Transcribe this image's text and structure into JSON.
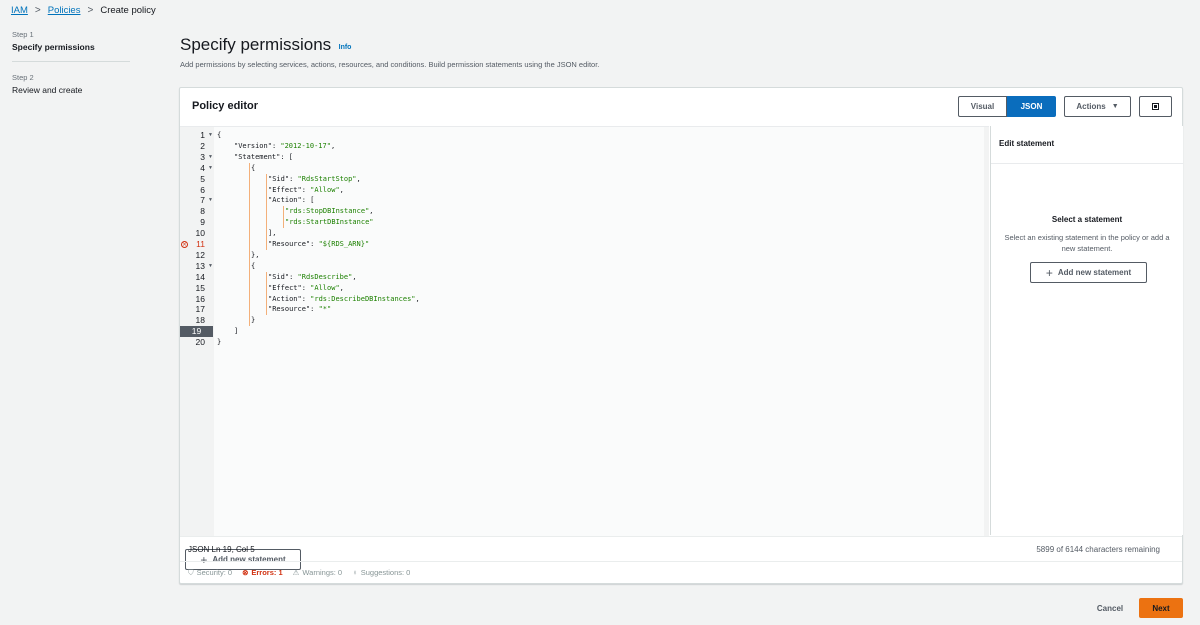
{
  "breadcrumb": {
    "iam": "IAM",
    "policies": "Policies",
    "current": "Create policy",
    "separator": ">"
  },
  "steps": [
    {
      "num": "Step 1",
      "title": "Specify permissions",
      "active": true
    },
    {
      "num": "Step 2",
      "title": "Review and create",
      "active": false
    }
  ],
  "page": {
    "title": "Specify permissions",
    "info": "Info",
    "description": "Add permissions by selecting services, actions, resources, and conditions. Build permission statements using the JSON editor."
  },
  "editor": {
    "title": "Policy editor",
    "mode_visual": "Visual",
    "mode_json": "JSON",
    "actions_label": "Actions",
    "add_statement": "Add new statement",
    "error_line": 11,
    "active_line": 19,
    "lines": [
      {
        "n": "1",
        "fold": true,
        "indent": 0,
        "tokens": [
          [
            "p",
            "{"
          ]
        ]
      },
      {
        "n": "2",
        "fold": false,
        "indent": 1,
        "tokens": [
          [
            "k",
            "\"Version\""
          ],
          [
            "p",
            ": "
          ],
          [
            "s",
            "\"2012-10-17\""
          ],
          [
            "p",
            ","
          ]
        ]
      },
      {
        "n": "3",
        "fold": true,
        "indent": 1,
        "tokens": [
          [
            "k",
            "\"Statement\""
          ],
          [
            "p",
            ": ["
          ]
        ]
      },
      {
        "n": "4",
        "fold": true,
        "indent": 2,
        "tokens": [
          [
            "p",
            "{"
          ]
        ]
      },
      {
        "n": "5",
        "fold": false,
        "indent": 3,
        "tokens": [
          [
            "k",
            "\"Sid\""
          ],
          [
            "p",
            ": "
          ],
          [
            "s",
            "\"RdsStartStop\""
          ],
          [
            "p",
            ","
          ]
        ]
      },
      {
        "n": "6",
        "fold": false,
        "indent": 3,
        "tokens": [
          [
            "k",
            "\"Effect\""
          ],
          [
            "p",
            ": "
          ],
          [
            "s",
            "\"Allow\""
          ],
          [
            "p",
            ","
          ]
        ]
      },
      {
        "n": "7",
        "fold": true,
        "indent": 3,
        "tokens": [
          [
            "k",
            "\"Action\""
          ],
          [
            "p",
            ": ["
          ]
        ]
      },
      {
        "n": "8",
        "fold": false,
        "indent": 4,
        "tokens": [
          [
            "s",
            "\"rds:StopDBInstance\""
          ],
          [
            "p",
            ","
          ]
        ]
      },
      {
        "n": "9",
        "fold": false,
        "indent": 4,
        "tokens": [
          [
            "s",
            "\"rds:StartDBInstance\""
          ]
        ]
      },
      {
        "n": "10",
        "fold": false,
        "indent": 3,
        "tokens": [
          [
            "p",
            "],"
          ]
        ]
      },
      {
        "n": "11",
        "fold": false,
        "indent": 3,
        "tokens": [
          [
            "k",
            "\"Resource\""
          ],
          [
            "p",
            ": "
          ],
          [
            "s",
            "\"${RDS_ARN}\""
          ]
        ]
      },
      {
        "n": "12",
        "fold": false,
        "indent": 2,
        "tokens": [
          [
            "p",
            "},"
          ]
        ]
      },
      {
        "n": "13",
        "fold": true,
        "indent": 2,
        "tokens": [
          [
            "p",
            "{"
          ]
        ]
      },
      {
        "n": "14",
        "fold": false,
        "indent": 3,
        "tokens": [
          [
            "k",
            "\"Sid\""
          ],
          [
            "p",
            ": "
          ],
          [
            "s",
            "\"RdsDescribe\""
          ],
          [
            "p",
            ","
          ]
        ]
      },
      {
        "n": "15",
        "fold": false,
        "indent": 3,
        "tokens": [
          [
            "k",
            "\"Effect\""
          ],
          [
            "p",
            ": "
          ],
          [
            "s",
            "\"Allow\""
          ],
          [
            "p",
            ","
          ]
        ]
      },
      {
        "n": "16",
        "fold": false,
        "indent": 3,
        "tokens": [
          [
            "k",
            "\"Action\""
          ],
          [
            "p",
            ": "
          ],
          [
            "s",
            "\"rds:DescribeDBInstances\""
          ],
          [
            "p",
            ","
          ]
        ]
      },
      {
        "n": "17",
        "fold": false,
        "indent": 3,
        "tokens": [
          [
            "k",
            "\"Resource\""
          ],
          [
            "p",
            ": "
          ],
          [
            "s",
            "\"*\""
          ]
        ]
      },
      {
        "n": "18",
        "fold": false,
        "indent": 2,
        "tokens": [
          [
            "p",
            "}"
          ]
        ]
      },
      {
        "n": "19",
        "fold": false,
        "indent": 1,
        "tokens": [
          [
            "p",
            "]"
          ]
        ]
      },
      {
        "n": "20",
        "fold": false,
        "indent": 0,
        "tokens": [
          [
            "p",
            "}"
          ]
        ]
      }
    ],
    "status_left": "JSON  Ln 19, Col 5",
    "status_right": "5899 of 6144 characters remaining",
    "issues": {
      "security": "Security: 0",
      "errors": "Errors: 1",
      "warnings": "Warnings: 0",
      "suggestions": "Suggestions: 0"
    }
  },
  "side_panel": {
    "title": "Edit statement",
    "empty_title": "Select a statement",
    "empty_desc": "Select an existing statement in the policy or add a new statement.",
    "add_statement": "Add new statement"
  },
  "footer": {
    "cancel": "Cancel",
    "next": "Next"
  },
  "colors": {
    "accent": "#0a6dbd",
    "primary_button": "#ec7211",
    "error": "#d13212",
    "string": "#1d8102",
    "link": "#0073bb"
  }
}
